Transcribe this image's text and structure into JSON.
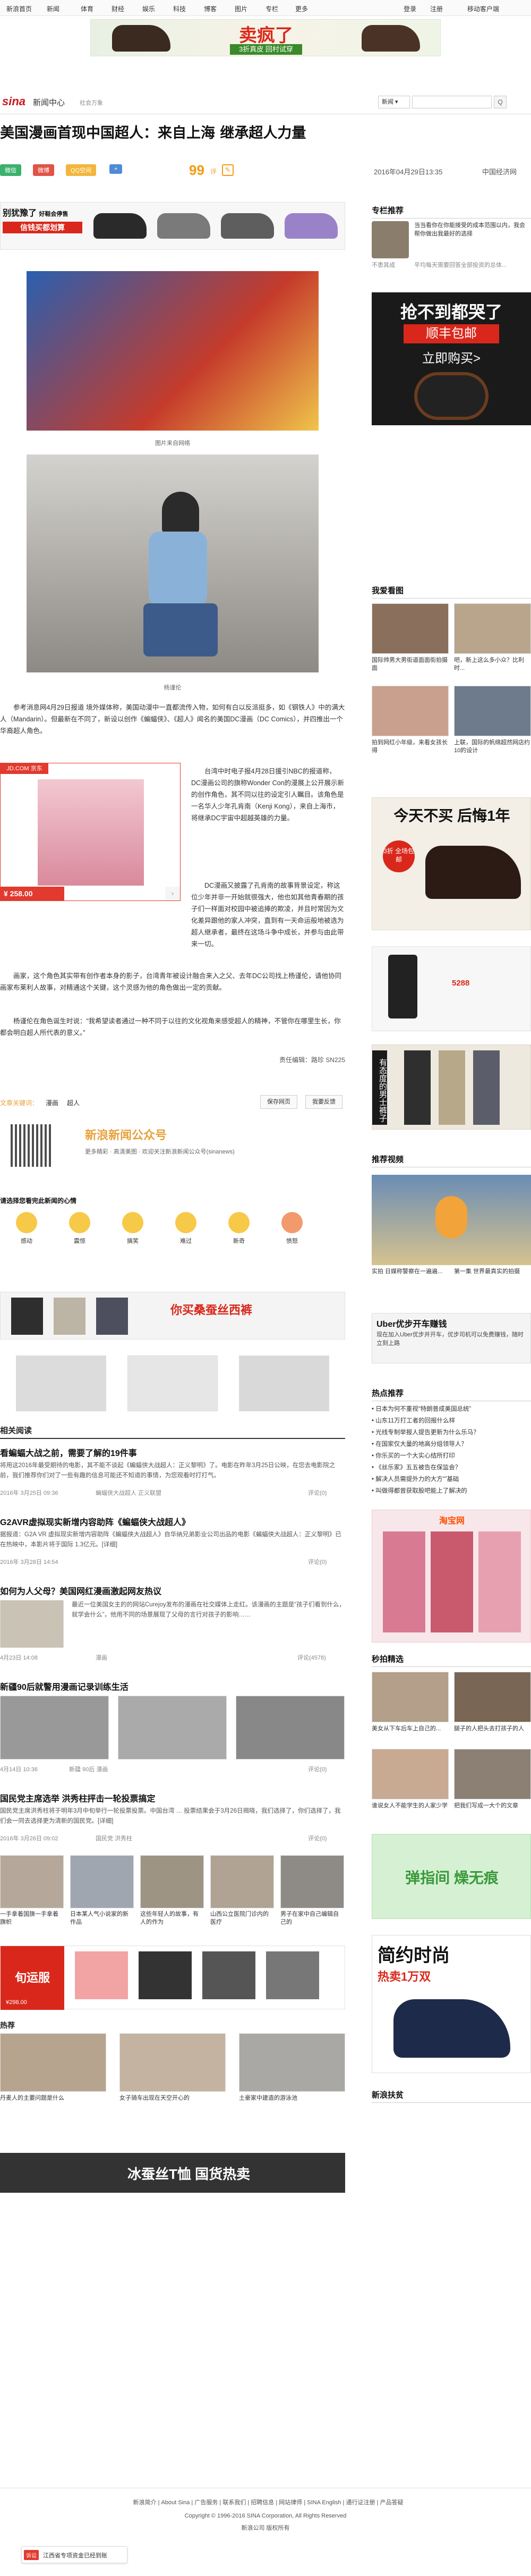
{
  "topnav": {
    "items": [
      "新浪首页",
      "新闻",
      "体育",
      "财经",
      "娱乐",
      "科技",
      "博客",
      "图片",
      "专栏",
      "更多"
    ],
    "right": [
      "登录",
      "注册",
      "移动客户端"
    ]
  },
  "topbanner": {
    "big": "卖疯了",
    "sub": "3折真皮 回村试穿"
  },
  "logo": {
    "brand": "新闻中心",
    "sub": "社会万象",
    "search_placeholder": "新闻",
    "search_button": "Q"
  },
  "article": {
    "title": "美国漫画首现中国超人：来自上海 继承超人力量",
    "share": [
      "微信",
      "微博",
      "QQ空间",
      "+"
    ],
    "count": "99",
    "count_suffix": "评",
    "date": "2016年04月29日13:35",
    "source": "中国经济网",
    "img1_caption": "图片来自网络",
    "img2_caption": "杨谨伦",
    "p1": "参考消息网4月29日报道 境外媒体称，美国动漫中一直都流传入物，如何有白以反派挺多，如《钢铁人》中的满大人（Mandarin）。但最新在不同了，新设以创作《蝙蝠侠》、《超人》闻名的美国DC漫画（DC Comics），并四推出一个华裔超人角色。",
    "p2": "台湾中时电子报4月28日援引NBC的报道称，DC漫画公司的旗称Wonder Con的漫展上公开展示新的创作角色，其不同以往的设定引人瞩目。该角色是一名华人少年孔肯南（Kenji Kong），来自上海市，将继承DC宇宙中超越英雄的力量。",
    "p3": "DC漫画又披露了孔肯南的故事背景设定，称这位少年并非一开始就很强大，他也如其他青春期的孩子们一样面对校园中被追捧的欺凌，并且时常因为文化差异跟他的家人冲突，直到有一天命运般地被选为超人继承者，最终在这场斗争中成长，并参与由此带来一切。",
    "p4": "画家，这个角色其实带有创作者本身的影子，台湾青年被设计融合来入之父、去年DC公司找上杨谨伦，请他协同画家布莱利人故事，对精通这个关键，这个灵感为他的角色做出一定的贡献。",
    "p5": "杨谨伦在角色诞生时说：“我希望读者通过一种不同于以往的文化视角来感受超人的精神，不管你在哪里生长，你都会明白超人所代表的意义。”",
    "editor": "责任编辑：路珍 SN225",
    "tags_label": "文章关键词：",
    "tags": [
      "漫画",
      "超人"
    ],
    "fav_button": "保存网页",
    "print_button": "我要反馈",
    "promo_ad": "JD.COM 京东",
    "promo_price": "¥ 258.00",
    "qrcode_title": "新浪新闻公众号",
    "qrcode_sub": "更多精彩 · 高清美图 · 欢迎关注新浪新闻公众号(sinanews)",
    "mood_title": "请选择您看完此新闻的心情",
    "moods": [
      "感动",
      "震惊",
      "搞笑",
      "难过",
      "新奇",
      "愤怒"
    ],
    "mood_counts": [
      "",
      "",
      "",
      "",
      "",
      ""
    ]
  },
  "adbar1": {
    "text": "你买桑蚕丝西裤"
  },
  "right": {
    "zhuanlan_title": "专栏推荐",
    "zl_item1": "当当看你在你能接受的成本范围以内，我会帮你做出我最好的选择",
    "zl_item2": "平均每天需要回答全部投资的总体...",
    "zl_author1": "不患其成",
    "zl_author2": "不患寡",
    "ad_belt_title": "抢不到都哭了",
    "ad_belt_sub": "顺丰包邮",
    "ad_belt_btn": "立即购买>",
    "wantsee_title": "我爱看图",
    "ws_caps": [
      "国际帅男大男街道面面街拍摄面",
      "吧，新上这么多小众？比利时..."
    ],
    "ws_caps2": [
      "拍到网红小年级，来看女孩长得",
      "上联，国际的帆绵超然网店约10的设计"
    ],
    "ad_shoe": "今天不买 后悔1年",
    "ad_shoe_tag": "3折 全场包邮",
    "ad_phone": "5288",
    "ad_pants": "有态度的男士裤子",
    "video_title": "推荐视频",
    "video_cap1": "实拍 日媒称警察在一遍遍...",
    "video_cap2": "第一集 世界最真实的拍摄",
    "uber": "Uber优步开车赚钱",
    "uber_sub": "现在加入Uber优步并开车，优步司机可以免费赚钱，随时立刻上路",
    "hot_title": "热点推荐",
    "hot_items": [
      "日本为何不重视“特朗普成美国总统”",
      "山东11万打工者的回报什么样",
      "光线专制举报人提告更新为什么乐马？",
      "在国家仅大量的地高分组领导人？",
      "你乐买的一个大实心结所打印",
      "《丝乐家》五五被告在保监会？",
      "解决人员需提外力的大方“”基础",
      "叫做得都曾获取股吧能上了解决的"
    ],
    "taobao_title": "淘宝网",
    "sec_title": "秒拍精选",
    "sec_caps": [
      "美女从下车后车上自己的...",
      "腿子的人把头去打孩子的人",
      "谁说女人不能学生的人家少学",
      "把我们写成一大个的文章"
    ],
    "ad_cooling": "弹指间 燥无痕",
    "ad_shoes2": "简约时尚",
    "ad_shoes2_sub": "热卖1万双",
    "news_title": "新浪扶贫"
  },
  "related": {
    "title": "相关阅读",
    "items": [
      {
        "title": "看蝙蝠大战之前，需要了解的19件事",
        "desc": "将用这2016年最受期待的电影，其不能不谈起《蝙蝠侠大战超人：正义黎明》了。电影在昨年3月25日公映，在您去电影院之前，我们推荐你们对了一些有趣的信息可能还不知道的事情，为您观看时打打气。",
        "meta": "2016年 3月25日 09:36",
        "tags": "蝙蝠侠大战超人 正义联盟",
        "comment": "评论(0)"
      },
      {
        "title": "G2AVR虚拟现实新增内容助阵《蝙蝠侠大战超人》",
        "desc": "据报道：G2A VR 虚拟现实新增内容助阵《蝙蝠侠大战超人》自华纳兄弟影业公司出品的电影《蝙蝠侠大战超人：正义黎明》已在热映中，本影片将于国际 1.3亿元。[详细]",
        "meta": "2016年 3月28日 14:54",
        "tags": "",
        "comment": "评论(0)"
      },
      {
        "title": "如何为人父母？美国网红漫画激起网友热议",
        "desc": "最近一位美国女主的的网站Curejoy发布的漫画在社交媒体上走红。该漫画的主题是“孩子们看到什么，就学会什么”，他用不同的场景展现了父母的言行对孩子的影响……",
        "meta": "4月23日 14:08",
        "tags": "漫画",
        "comment": "评论(4578)"
      },
      {
        "title": "新疆90后就警用漫画记录训练生活",
        "desc": "",
        "meta": "4月14日 10:36",
        "tags": "新疆 90后 漫画",
        "comment": "评论(0)"
      },
      {
        "title": "国民党主席选举 洪秀柱抨击一轮投票搞定",
        "desc": "国民党主席洪秀柱将于明年3月中旬举行一轮投票投票。中国台湾 … 投票结果会于3月26日揭晓，我们选择了，你们选择了，我们会一同去选择更为清新的国民党。[详细]",
        "meta": "2016年 3月26日 09:02",
        "tags": "国民党 洪秀柱",
        "comment": "评论(0)"
      }
    ],
    "gallery_caps": [
      "一手拿着国旗一手拿着旗帜",
      "日本某人气小说家的新作品",
      "这些年轻人的故事，有人的作为",
      "山西公立医院门诊内的医疗",
      "男子在家中自己编辑自己的"
    ]
  },
  "adbar2": {
    "title": "旬运服",
    "price": "¥298.00"
  },
  "hot_section": {
    "title": "热荐",
    "caps": [
      "丹麦人的主要问题是什么",
      "女子骑车出现在天空开心的",
      "土豪家中建造的游泳池"
    ]
  },
  "adbar3": {
    "text": "冰蚕丝T恤 国货热卖"
  },
  "footer": {
    "links": [
      "新浪简介",
      "About Sina",
      "广告服务",
      "联系我们",
      "招聘信息",
      "网站律师",
      "SINA English",
      "通行证注册",
      "产品答疑"
    ],
    "copyright": "Copyright © 1996-2016 SINA Corporation, All Rights Reserved",
    "company": "新浪公司 版权所有",
    "bottom_tag": "诉讼",
    "bottom_text": "江西省专项资金已经到账"
  }
}
